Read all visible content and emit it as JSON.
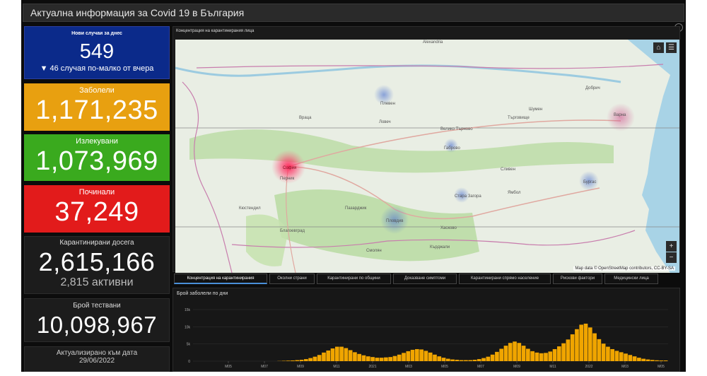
{
  "header": {
    "title": "Актуална информация за Covid 19 в България"
  },
  "cards": {
    "new_today": {
      "label": "Нови случаи за днес",
      "value": "549",
      "delta": "▼ 46 случая по-малко от вчера"
    },
    "sick": {
      "label": "Заболели",
      "value": "1,171,235"
    },
    "healed": {
      "label": "Излекувани",
      "value": "1,073,969"
    },
    "dead": {
      "label": "Починали",
      "value": "37,249"
    },
    "quarantined": {
      "label": "Карантинирани досега",
      "value": "2,615,166",
      "active": "2,815 активни"
    },
    "tests": {
      "label": "Брой тествани",
      "value": "10,098,967"
    },
    "updated": {
      "label": "Актуализирано към дата",
      "date": "29/06/2022"
    }
  },
  "map": {
    "title": "Концентрация на карантинирания лица",
    "attribution": "Map data © OpenStreetMap contributors, CC-BY-SA",
    "zoom_in": "+",
    "zoom_out": "−",
    "home_icon": "home-icon",
    "legend_icon": "list-icon",
    "places": {
      "alexandria": "Alexandria",
      "vratsa": "Враца",
      "pleven": "Плевен",
      "veliko": "Велико Търново",
      "varna": "Варна",
      "sofia": "София",
      "plovdiv": "Пловдив",
      "burgas": "Бургас",
      "stara": "Стара Загора",
      "lovech": "Ловеч",
      "pernik": "Перник",
      "kyustendil": "Кюстендил",
      "blagoevgrad": "Благоевград",
      "sliven": "Сливен",
      "yambol": "Ямбол",
      "shumen": "Шумен",
      "dobrich": "Добрич",
      "haskovo": "Хасково",
      "gabrovo": "Габрово",
      "pazardzhik": "Пазарджик",
      "kardzhali": "Кърджали",
      "smolyan": "Смолян",
      "targovishte": "Търговище"
    },
    "hotspot_color": "#ff3355"
  },
  "tabs": [
    "Концентрация на карантинирания",
    "Околни страни",
    "Карантинирани по общини",
    "Доказване симптоми",
    "Карантинирани спрямо население",
    "Рискови фактори",
    "Медицински лица"
  ],
  "chart_data": {
    "type": "bar",
    "title": "Брой заболели по дни",
    "y_ticks": [
      "15k",
      "10k",
      "5k",
      "0"
    ],
    "ylim": [
      0,
      15000
    ],
    "x_ticks": [
      "M05",
      "M07",
      "M09",
      "M11",
      "2021",
      "M03",
      "M05",
      "M07",
      "M09",
      "M11",
      "2022",
      "M03",
      "M05"
    ],
    "color": "#f0a500",
    "series": [
      {
        "values": [
          0,
          0,
          0,
          0,
          0,
          0,
          0,
          0,
          0,
          0,
          0,
          0,
          0,
          0,
          0,
          0,
          0,
          0,
          0,
          50,
          100,
          150,
          200,
          300,
          400,
          600,
          900,
          1300,
          1800,
          2500,
          3100,
          3700,
          4200,
          4200,
          3800,
          3200,
          2600,
          2100,
          1700,
          1400,
          1200,
          1000,
          1000,
          1100,
          1200,
          1500,
          1900,
          2400,
          2900,
          3300,
          3500,
          3400,
          3000,
          2500,
          1900,
          1400,
          1000,
          700,
          500,
          400,
          300,
          300,
          300,
          400,
          600,
          900,
          1300,
          1900,
          2700,
          3600,
          4500,
          5300,
          5700,
          5300,
          4500,
          3600,
          2900,
          2500,
          2300,
          2400,
          2800,
          3500,
          4300,
          5200,
          6300,
          7800,
          9300,
          10600,
          10900,
          9800,
          8100,
          6400,
          5100,
          4200,
          3500,
          3000,
          2600,
          2200,
          1800,
          1400,
          1000,
          700,
          500,
          350,
          250,
          200,
          200
        ]
      }
    ]
  }
}
